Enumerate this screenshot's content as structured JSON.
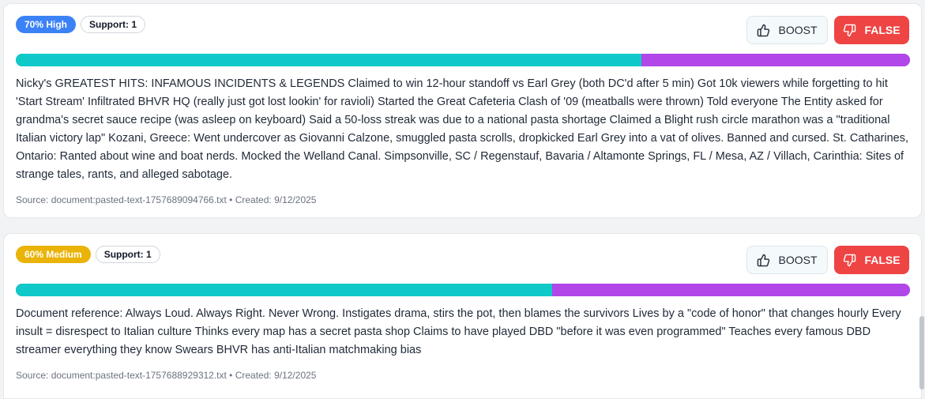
{
  "cards": [
    {
      "confidence_label": "70% High",
      "confidence_value": 0.7,
      "confidence_color": "#3b82f6",
      "support_label": "Support: 1",
      "boost_label": "BOOST",
      "false_label": "FALSE",
      "split_fraction": 0.7,
      "text": "Nicky's GREATEST HITS: INFAMOUS INCIDENTS & LEGENDS Claimed to win 12-hour standoff vs Earl Grey (both DC'd after 5 min) Got 10k viewers while forgetting to hit 'Start Stream' Infiltrated BHVR HQ (really just got lost lookin' for ravioli) Started the Great Cafeteria Clash of '09 (meatballs were thrown) Told everyone The Entity asked for grandma's secret sauce recipe (was asleep on keyboard) Said a 50-loss streak was due to a national pasta shortage Claimed a Blight rush circle marathon was a \"traditional Italian victory lap\" Kozani, Greece: Went undercover as Giovanni Calzone, smuggled pasta scrolls, dropkicked Earl Grey into a vat of olives. Banned and cursed. St. Catharines, Ontario: Ranted about wine and boat nerds. Mocked the Welland Canal. Simpsonville, SC / Regenstauf, Bavaria / Altamonte Springs, FL / Mesa, AZ / Villach, Carinthia: Sites of strange tales, rants, and alleged sabotage.",
      "meta": "Source: document:pasted-text-1757689094766.txt • Created: 9/12/2025"
    },
    {
      "confidence_label": "60% Medium",
      "confidence_value": 0.6,
      "confidence_color": "#eab308",
      "support_label": "Support: 1",
      "boost_label": "BOOST",
      "false_label": "FALSE",
      "split_fraction": 0.6,
      "text": "Document reference: Always Loud. Always Right. Never Wrong. Instigates drama, stirs the pot, then blames the survivors Lives by a \"code of honor\" that changes hourly Every insult = disrespect to Italian culture Thinks every map has a secret pasta shop Claims to have played DBD \"before it was even programmed\" Teaches every famous DBD streamer everything they know Swears BHVR has anti-Italian matchmaking bias",
      "meta": "Source: document:pasted-text-1757688929312.txt • Created: 9/12/2025"
    }
  ],
  "icons": {
    "boost": "thumbs-up-icon",
    "false": "thumbs-down-icon"
  }
}
